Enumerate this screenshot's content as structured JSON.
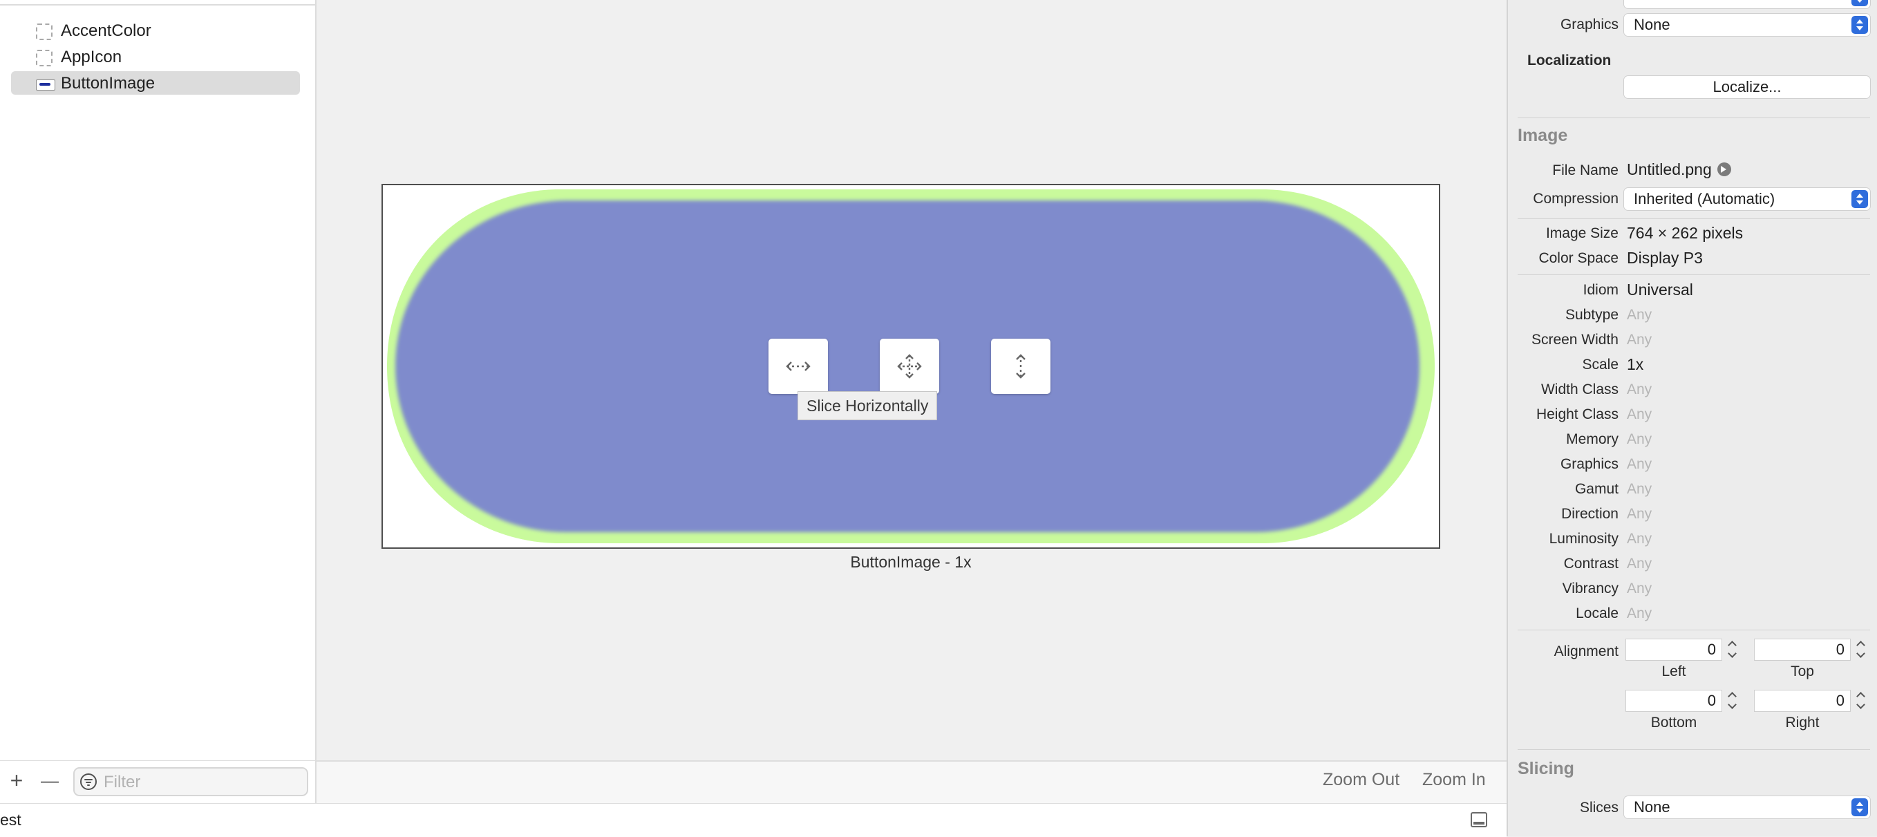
{
  "navigator": {
    "items": [
      {
        "label": "AccentColor",
        "icon": "color-set-icon",
        "selected": false
      },
      {
        "label": "AppIcon",
        "icon": "app-icon-set-icon",
        "selected": false
      },
      {
        "label": "ButtonImage",
        "icon": "image-set-icon",
        "selected": true
      }
    ],
    "add_label": "+",
    "remove_label": "—",
    "filter_placeholder": "Filter"
  },
  "canvas": {
    "caption": "ButtonImage - 1x",
    "tools": [
      "slice-horizontally-icon",
      "slice-both-icon",
      "slice-vertically-icon"
    ],
    "tooltip": "Slice Horizontally",
    "zoom_out": "Zoom Out",
    "zoom_in": "Zoom In",
    "colors": {
      "fill": "#7f8bcc",
      "outline": "#c9fa9c"
    }
  },
  "status_bar": {
    "text": "est"
  },
  "inspector": {
    "graphics_label": "Graphics",
    "graphics_value": "None",
    "localization": {
      "heading": "Localization",
      "button": "Localize..."
    },
    "image": {
      "heading": "Image",
      "file_name_label": "File Name",
      "file_name": "Untitled.png",
      "compression_label": "Compression",
      "compression": "Inherited (Automatic)",
      "size_label": "Image Size",
      "size": "764 × 262 pixels",
      "color_space_label": "Color Space",
      "color_space": "Display P3",
      "idiom_label": "Idiom",
      "idiom": "Universal",
      "subtype_label": "Subtype",
      "subtype": "Any",
      "screen_width_label": "Screen Width",
      "screen_width": "Any",
      "scale_label": "Scale",
      "scale": "1x",
      "width_class_label": "Width Class",
      "width_class": "Any",
      "height_class_label": "Height Class",
      "height_class": "Any",
      "memory_label": "Memory",
      "memory": "Any",
      "graphics_label": "Graphics",
      "graphics": "Any",
      "gamut_label": "Gamut",
      "gamut": "Any",
      "direction_label": "Direction",
      "direction": "Any",
      "luminosity_label": "Luminosity",
      "luminosity": "Any",
      "contrast_label": "Contrast",
      "contrast": "Any",
      "vibrancy_label": "Vibrancy",
      "vibrancy": "Any",
      "locale_label": "Locale",
      "locale": "Any"
    },
    "alignment": {
      "label": "Alignment",
      "left": "0",
      "left_label": "Left",
      "top": "0",
      "top_label": "Top",
      "bottom": "0",
      "bottom_label": "Bottom",
      "right": "0",
      "right_label": "Right"
    },
    "slicing": {
      "heading": "Slicing",
      "slices_label": "Slices",
      "slices": "None"
    }
  }
}
